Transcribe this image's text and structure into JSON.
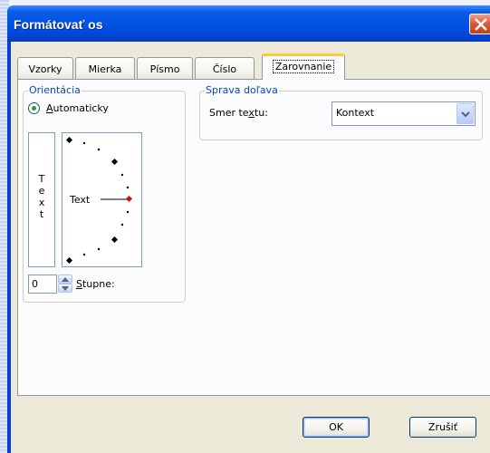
{
  "window": {
    "title": "Formátovať os"
  },
  "tabs": [
    {
      "label": "Vzorky"
    },
    {
      "label": "Mierka"
    },
    {
      "label": "Písmo"
    },
    {
      "label": "Číslo"
    },
    {
      "label": "Zarovnanie"
    }
  ],
  "orientation": {
    "group_label": "Orientácia",
    "auto_label": "Automaticky",
    "vertical_letters": [
      "T",
      "e",
      "x",
      "t"
    ],
    "dial_text": "Text",
    "degrees_value": "0",
    "degrees_label": "Stupne:"
  },
  "rtl": {
    "group_label": "Sprava doľava",
    "direction_label": "Smer textu:",
    "direction_value": "Kontext"
  },
  "buttons": {
    "ok": "OK",
    "cancel": "Zrušiť"
  },
  "colors": {
    "title_bar": "#0054e3",
    "active_tab_accent": "#ffc83c",
    "group_label": "#0046d5",
    "dial_marker": "#d01010"
  }
}
